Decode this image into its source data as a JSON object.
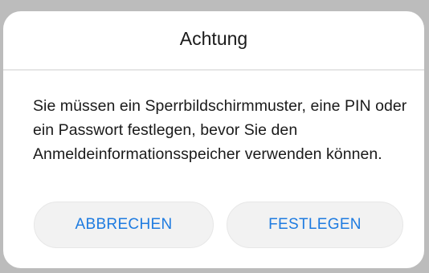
{
  "dialog": {
    "title": "Achtung",
    "message": "Sie müssen ein Sperrbildschirmmuster, eine PIN oder ein Passwort festlegen, bevor Sie den Anmeldeinformationsspeicher verwenden können.",
    "buttons": {
      "cancel_label": "ABBRECHEN",
      "confirm_label": "FESTLEGEN"
    }
  },
  "colors": {
    "accent": "#1e7be0",
    "button_bg": "#f2f2f2",
    "backdrop": "#bcbcbc"
  }
}
